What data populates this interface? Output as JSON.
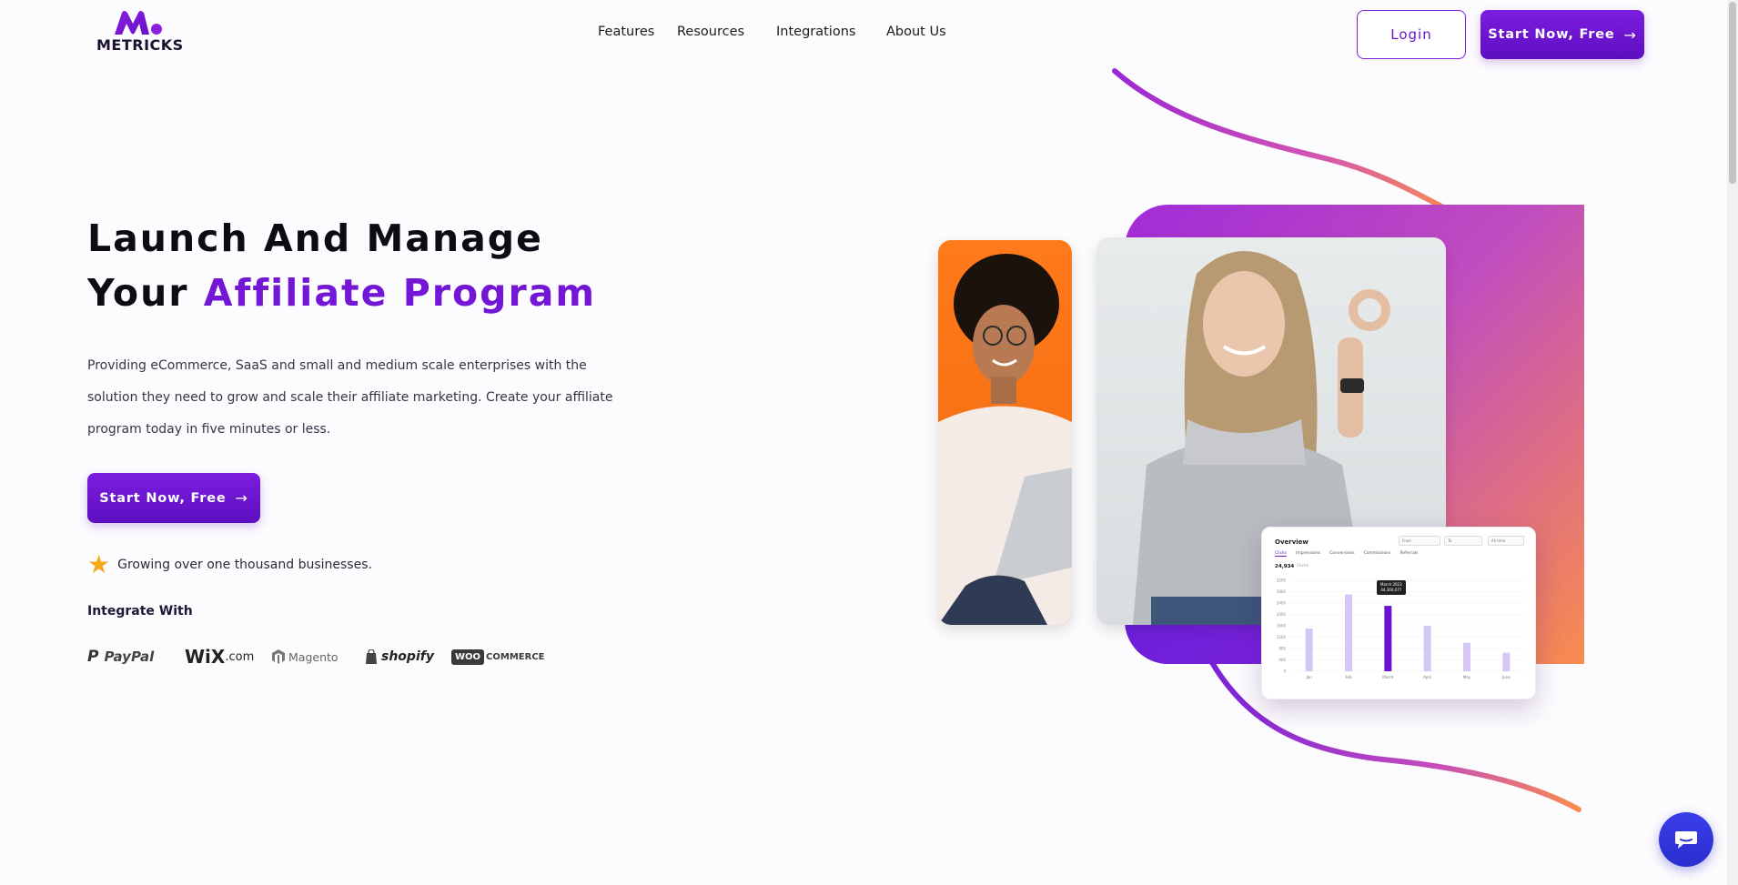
{
  "header": {
    "logo_text": "METRICKS",
    "nav": [
      "Features",
      "Resources",
      "Integrations",
      "About Us"
    ],
    "login_label": "Login",
    "start_label": "Start Now, Free",
    "arrow": "→"
  },
  "hero": {
    "title_line1": "Launch And Manage",
    "title_line2_prefix": "Your ",
    "title_line2_accent": "Affiliate Program",
    "description": "Providing eCommerce, SaaS and small and medium scale enterprises with the solution they need to grow and scale their affiliate marketing. Create your affiliate program today in five minutes or less.",
    "cta_label": "Start Now, Free",
    "growing_text": "Growing over one thousand businesses.",
    "integrate_label": "Integrate With",
    "brands": [
      "PayPal",
      "WiX",
      ".com",
      "Magento",
      "shopify",
      "WOO",
      "COMMERCE"
    ]
  },
  "dashboard": {
    "title": "Overview",
    "filter_from": "From",
    "filter_to": "To",
    "filter_all": "All time",
    "tabs": [
      "Clicks",
      "Impressions",
      "Conversions",
      "Commissions",
      "Referrals"
    ],
    "total": "24,934",
    "total_label": "Clicks",
    "tooltip_date": "March 2023",
    "tooltip_value": "44,360,077",
    "chart_categories": [
      "Jan",
      "Feb",
      "March",
      "April",
      "May",
      "June"
    ],
    "chart_values": [
      1500,
      2700,
      2300,
      1600,
      1000,
      650
    ],
    "y_ticks": [
      "3200",
      "2800",
      "2400",
      "2000",
      "1600",
      "1200",
      "800",
      "400",
      "0"
    ]
  },
  "colors": {
    "accent": "#7416d6",
    "primary_button": "#6a18c4",
    "star": "#f6a81c",
    "chat": "#2a2ed0"
  }
}
